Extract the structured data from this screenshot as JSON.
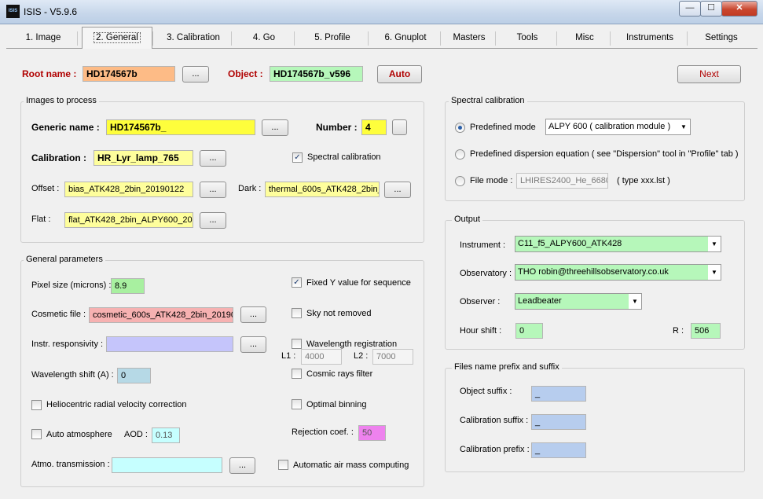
{
  "window": {
    "title": "ISIS - V5.9.6",
    "icon_text": "ISIS",
    "min": "—",
    "max": "☐",
    "close": "✕"
  },
  "tabs": [
    "1. Image",
    "2. General",
    "3. Calibration",
    "4. Go",
    "5. Profile",
    "6. Gnuplot",
    "Masters",
    "Tools",
    "Misc",
    "Instruments",
    "Settings"
  ],
  "active_tab": "2. General",
  "header": {
    "root_label": "Root name :",
    "root_value": "HD174567b",
    "object_label": "Object :",
    "object_value": "HD174567b_v596",
    "auto_label": "Auto",
    "next_label": "Next",
    "browse": "..."
  },
  "images": {
    "title": "Images to process",
    "generic_label": "Generic name :",
    "generic_value": "HD174567b_",
    "number_label": "Number :",
    "number_value": "4",
    "calibration_label": "Calibration :",
    "calibration_value": "HR_Lyr_lamp_765",
    "spectral_cal_label": "Spectral calibration",
    "offset_label": "Offset :",
    "offset_value": "bias_ATK428_2bin_20190122",
    "dark_label": "Dark :",
    "dark_value": "thermal_600s_ATK428_2bin_",
    "flat_label": "Flat :",
    "flat_value": "flat_ATK428_2bin_ALPY600_201"
  },
  "general": {
    "title": "General parameters",
    "pixel_label": "Pixel size (microns) :",
    "pixel_value": "8.9",
    "cosmetic_label": "Cosmetic file :",
    "cosmetic_value": "cosmetic_600s_ATK428_2bin_20190",
    "responsivity_label": "Instr. responsivity :",
    "responsivity_value": "",
    "wlshift_label": "Wavelength shift (A) :",
    "wlshift_value": "0",
    "helio_label": "Heliocentric radial velocity correction",
    "autoatmo_label": "Auto atmosphere",
    "aod_label": "AOD :",
    "aod_value": "0.13",
    "atmo_label": "Atmo. transmission :",
    "atmo_value": "",
    "fixedy_label": "Fixed Y value for sequence",
    "sky_label": "Sky not removed",
    "wlreg_label": "Wavelength registration",
    "l1_label": "L1 :",
    "l1_value": "4000",
    "l2_label": "L2 :",
    "l2_value": "7000",
    "cosmicray_label": "Cosmic rays filter",
    "optimal_label": "Optimal binning",
    "rejection_label": "Rejection coef. :",
    "rejection_value": "50",
    "airmass_label": "Automatic air mass computing"
  },
  "spectral": {
    "title": "Spectral calibration",
    "predefined_label": "Predefined mode",
    "predefined_value": "ALPY 600 ( calibration module )",
    "dispersion_label": "Predefined dispersion equation ( see \"Dispersion\" tool in \"Profile\" tab )",
    "filemode_label": "File mode :",
    "filemode_value": "LHIRES2400_He_6680",
    "filemode_hint": "( type xxx.lst )"
  },
  "output": {
    "title": "Output",
    "instrument_label": "Instrument :",
    "instrument_value": "C11_f5_ALPY600_ATK428",
    "observatory_label": "Observatory :",
    "observatory_value": "THO   robin@threehillsobservatory.co.uk",
    "observer_label": "Observer :",
    "observer_value": "Leadbeater",
    "hourshift_label": "Hour shift :",
    "hourshift_value": "0",
    "r_label": "R :",
    "r_value": "506"
  },
  "files": {
    "title": "Files name prefix and suffix",
    "object_suffix_label": "Object suffix :",
    "object_suffix_value": "_",
    "calib_suffix_label": "Calibration suffix :",
    "calib_suffix_value": "_",
    "calib_prefix_label": "Calibration prefix :",
    "calib_prefix_value": "_"
  },
  "colors": {
    "orange": "#fdbb86",
    "green": "#b6f7ba",
    "yellow": "#fefe3c",
    "paleyellow": "#fefe9c",
    "lightgreen": "#a8f0a0",
    "pink": "#f6b1b1",
    "lavender": "#c5c5fb",
    "lightblue": "#b6d9e6",
    "cyan": "#c6ffff",
    "magenta": "#ee82ee",
    "blue": "#b7cdee"
  }
}
